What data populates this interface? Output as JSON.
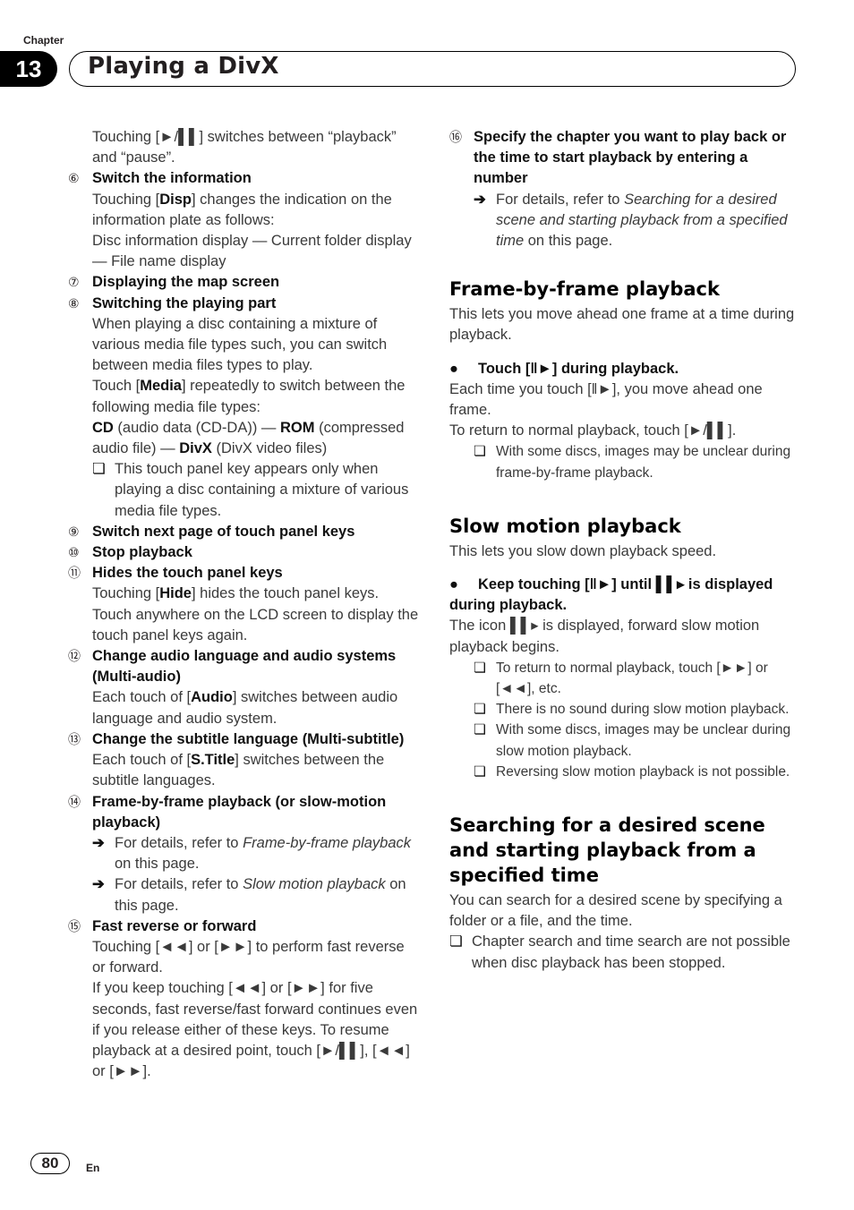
{
  "header": {
    "chapter_label": "Chapter",
    "chapter_number": "13",
    "chapter_title": "Playing a DivX"
  },
  "left_column": {
    "intro": "Touching [►/▌▌] switches between “playback” and “pause”.",
    "items": [
      {
        "num": "⑥",
        "title": "Switch the information",
        "body": [
          "Touching [Disp] changes the indication on the information plate as follows:",
          "Disc information display — Current folder display — File name display"
        ]
      },
      {
        "num": "⑦",
        "title": "Displaying the map screen"
      },
      {
        "num": "⑧",
        "title": "Switching the playing part",
        "body": [
          "When playing a disc containing a mixture of various media file types such, you can switch between media files types to play.",
          "Touch [Media] repeatedly to switch between the following media file types:",
          "CD (audio data (CD-DA)) — ROM (compressed audio file) — DivX (DivX video files)"
        ],
        "note": "This touch panel key appears only when playing a disc containing a mixture of various media file types."
      },
      {
        "num": "⑨",
        "title": "Switch next page of touch panel keys"
      },
      {
        "num": "⑩",
        "title": "Stop playback"
      },
      {
        "num": "⑪",
        "title": "Hides the touch panel keys",
        "body": [
          "Touching [Hide] hides the touch panel keys. Touch anywhere on the LCD screen to display the touch panel keys again."
        ]
      },
      {
        "num": "⑫",
        "title": "Change audio language and audio systems (Multi-audio)",
        "body": [
          "Each touch of [Audio] switches between audio language and audio system."
        ]
      },
      {
        "num": "⑬",
        "title": "Change the subtitle language (Multi-subtitle)",
        "body": [
          "Each touch of [S.Title] switches between the subtitle languages."
        ]
      },
      {
        "num": "⑭",
        "title": "Frame-by-frame playback (or slow-motion playback)",
        "refs": [
          {
            "prefix": "For details, refer to ",
            "link": "Frame-by-frame playback",
            "suffix": " on this page."
          },
          {
            "prefix": "For details, refer to ",
            "link": "Slow motion playback",
            "suffix": " on this page."
          }
        ]
      },
      {
        "num": "⑮",
        "title": "Fast reverse or forward",
        "body": [
          "Touching [◄◄] or [►►] to perform fast reverse or forward.",
          "If you keep touching [◄◄] or [►►] for five seconds, fast reverse/fast forward continues even if you release either of these keys. To resume playback at a desired point, touch [►/▌▌], [◄◄] or [►►]."
        ]
      }
    ]
  },
  "right_column": {
    "item16": {
      "num": "⑯",
      "title": "Specify the chapter you want to play back or the time to start playback by entering a number",
      "ref": {
        "prefix": "For details, refer to ",
        "link": "Searching for a desired scene and starting playback from a specified time",
        "suffix": " on this page."
      }
    },
    "frame_section": {
      "heading": "Frame-by-frame playback",
      "intro": "This lets you move ahead one frame at a time during playback.",
      "step": "Touch [‖►] during playback.",
      "body": [
        "Each time you touch [‖►], you move ahead one frame.",
        "To return to normal playback, touch [►/▌▌]."
      ],
      "notes": [
        "With some discs, images may be unclear during frame-by-frame playback."
      ]
    },
    "slow_section": {
      "heading": "Slow motion playback",
      "intro": "This lets you slow down playback speed.",
      "step": "Keep touching [‖►] until ▌▌▸ is displayed during playback.",
      "body": [
        "The icon ▌▌▸ is displayed, forward slow motion playback begins."
      ],
      "notes": [
        "To return to normal playback, touch [►►] or [◄◄], etc.",
        "There is no sound during slow motion playback.",
        "With some discs, images may be unclear during slow motion playback.",
        "Reversing slow motion playback is not possible."
      ]
    },
    "search_section": {
      "heading": "Searching for a desired scene and starting playback from a specified time",
      "intro": "You can search for a desired scene by specifying a folder or a file, and the time.",
      "notes": [
        "Chapter search and time search are not possible when disc playback has been stopped."
      ]
    }
  },
  "footer": {
    "page_number": "80",
    "language": "En"
  },
  "markers": {
    "note": "❏",
    "ref": "➔",
    "bullet": "●"
  }
}
